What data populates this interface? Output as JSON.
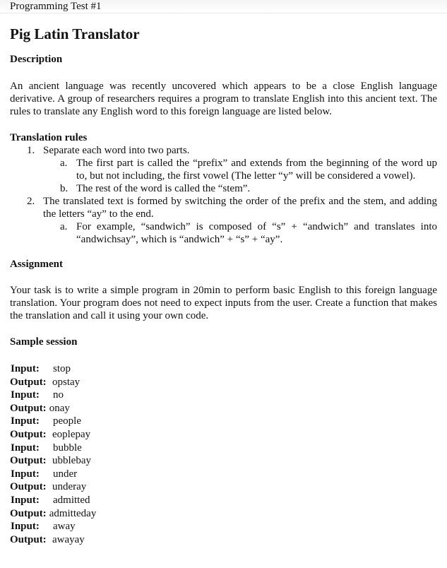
{
  "header": {
    "title": "Programming Test #1"
  },
  "document": {
    "title": "Pig Latin Translator",
    "description": {
      "heading": "Description",
      "text": "An ancient language was recently uncovered which appears to be a close English language derivative. A group of researchers requires a program to translate English into this ancient text. The rules to translate any English word to this foreign language are listed below."
    },
    "rules": {
      "heading": "Translation rules",
      "items": [
        {
          "num": "1.",
          "text": "Separate each word into two parts.",
          "sub": [
            {
              "letter": "a.",
              "text": "The first part is called the “prefix” and extends from the beginning of the word up to, but not including, the first vowel (The letter “y” will be considered a vowel)."
            },
            {
              "letter": "b.",
              "text": "The rest of the word is called the “stem”."
            }
          ]
        },
        {
          "num": "2.",
          "text": "The translated text is formed by switching the order of the prefix and the stem, and adding the letters “ay” to the end.",
          "sub": [
            {
              "letter": "a.",
              "text": "For example, “sandwich” is composed of “s” + “andwich” and translates into “andwichsay”, which is “andwich” + “s” + “ay”."
            }
          ]
        }
      ]
    },
    "assignment": {
      "heading": "Assignment",
      "text": "Your task is to write a simple program in 20min to perform basic English to this foreign language translation. Your program does not need to expect inputs from the user. Create a function that makes the translation and call it using your own code."
    },
    "sample": {
      "heading": "Sample session",
      "input_label": "Input:",
      "output_label": "Output:",
      "pairs": [
        {
          "input": "stop",
          "output": "opstay"
        },
        {
          "input": "no",
          "output": "onay"
        },
        {
          "input": "people",
          "output": "eoplepay"
        },
        {
          "input": "bubble",
          "output": "ubblebay"
        },
        {
          "input": "under",
          "output": "underay"
        },
        {
          "input": "admitted",
          "output": "admitteday"
        },
        {
          "input": "away",
          "output": "awayay"
        }
      ]
    }
  }
}
